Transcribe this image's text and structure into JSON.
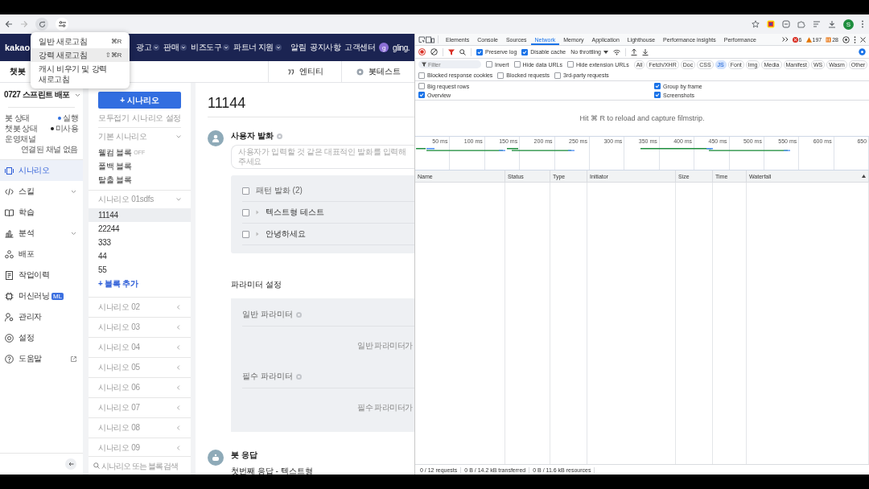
{
  "browser": {
    "avatar": "S"
  },
  "reload_menu": [
    {
      "label": "일반 새로고침",
      "shortcut": "⌘R",
      "highlighted": false
    },
    {
      "label": "강력 새로고침",
      "shortcut": "⇧⌘R",
      "highlighted": true
    },
    {
      "label": "캐시 비우기 및 강력 새로고침",
      "highlighted": false
    }
  ],
  "header": {
    "logo": "kakao",
    "menus": [
      "광고",
      "판매",
      "비즈도구",
      "파트너 지원"
    ],
    "links": [
      "알림",
      "공지사항",
      "고객센터"
    ],
    "user": {
      "initial": "g",
      "name": "gling."
    }
  },
  "subheader": {
    "title": "챗봇",
    "tabs": [
      "엔티티",
      "봇테스트"
    ]
  },
  "sidebar": {
    "bot_name": "0727 스프린트 배포",
    "status": [
      {
        "label": "봇 상태",
        "value": "실행",
        "color": "#2f6fdf"
      },
      {
        "label": "챗봇 상태",
        "value": "미사용",
        "color": "#222222"
      },
      {
        "label": "운영채널",
        "value": "연결된 채널 없음"
      }
    ],
    "nav": [
      {
        "label": "시나리오",
        "selected": true
      },
      {
        "label": "스킬",
        "selected": false,
        "expandable": true
      },
      {
        "label": "학습",
        "selected": false
      },
      {
        "label": "분석",
        "selected": false,
        "expandable": true
      },
      {
        "label": "배포",
        "selected": false
      },
      {
        "label": "작업이력",
        "selected": false
      },
      {
        "label": "머신러닝",
        "selected": false,
        "badge": "ML"
      },
      {
        "label": "관리자",
        "selected": false
      },
      {
        "label": "설정",
        "selected": false
      },
      {
        "label": "도움말",
        "selected": false,
        "external": true
      }
    ]
  },
  "scenarios": {
    "add_button": "+ 시나리오",
    "collapse_all": "모두접기",
    "settings": "시나리오 설정",
    "groups": [
      {
        "title": "기본 시나리오",
        "expanded": true,
        "blocks": [
          {
            "label": "웰컴 블록",
            "tag": "OFF",
            "selected": false
          },
          {
            "label": "폴백 블록",
            "selected": false
          },
          {
            "label": "탈출 블록",
            "selected": false
          }
        ]
      },
      {
        "title": "시나리오 01sdfs",
        "expanded": true,
        "blocks": [
          {
            "label": "11144",
            "selected": true
          },
          {
            "label": "22244",
            "selected": false
          },
          {
            "label": "333",
            "selected": false
          },
          {
            "label": "44",
            "selected": false
          },
          {
            "label": "55",
            "selected": false
          }
        ],
        "add_block": "+ 블록 추가"
      },
      {
        "title": "시나리오 02",
        "expanded": false
      },
      {
        "title": "시나리오 03",
        "expanded": false
      },
      {
        "title": "시나리오 04",
        "expanded": false
      },
      {
        "title": "시나리오 05",
        "expanded": false
      },
      {
        "title": "시나리오 06",
        "expanded": false
      },
      {
        "title": "시나리오 07",
        "expanded": false
      },
      {
        "title": "시나리오 08",
        "expanded": false
      },
      {
        "title": "시나리오 09",
        "expanded": false
      }
    ],
    "search": {
      "placeholder": "시나리오 또는 블록 검색"
    }
  },
  "main": {
    "title": "11144",
    "user_utterance": {
      "heading": "사용자 발화",
      "placeholder": "사용자가 입력할 것 같은 대표적인 발화를 입력해주세요",
      "items": [
        {
          "kind": "group",
          "label": "패턴 발화 (2)",
          "checked": false
        },
        {
          "kind": "utterance",
          "label": "텍스트형 테스트",
          "checked": false
        },
        {
          "kind": "utterance",
          "label": "안녕하세요",
          "checked": false
        }
      ]
    },
    "parameters": {
      "heading": "파라미터 설정",
      "sections": [
        {
          "title": "일반 파라미터",
          "empty_text": "일반 파라미터가"
        },
        {
          "title": "필수 파라미터",
          "empty_text": "필수 파라미터가"
        }
      ]
    },
    "bot_response": {
      "heading": "봇 응답",
      "subtitle": "첫번째 응답 - 텍스트형"
    }
  },
  "devtools": {
    "tabs": [
      {
        "label": "Elements",
        "selected": false
      },
      {
        "label": "Console",
        "selected": false
      },
      {
        "label": "Sources",
        "selected": false
      },
      {
        "label": "Network",
        "selected": true
      },
      {
        "label": "Memory",
        "selected": false
      },
      {
        "label": "Application",
        "selected": false
      },
      {
        "label": "Lighthouse",
        "selected": false
      },
      {
        "label": "Performance insights",
        "selected": false
      },
      {
        "label": "Performance",
        "selected": false
      }
    ],
    "issue_counts": [
      {
        "kind": "error",
        "count": "6"
      },
      {
        "kind": "warning",
        "count": "197"
      },
      {
        "kind": "issue",
        "count": "28"
      }
    ],
    "recording": true,
    "toolbar_checks": [
      {
        "label": "Preserve log",
        "checked": true
      },
      {
        "label": "Disable cache",
        "checked": true
      }
    ],
    "throttling": "No throttling",
    "filter": {
      "placeholder": "Filter"
    },
    "filter_checks": [
      {
        "label": "Invert",
        "checked": false
      },
      {
        "label": "Hide data URLs",
        "checked": false
      },
      {
        "label": "Hide extension URLs",
        "checked": false
      }
    ],
    "type_filters": [
      {
        "label": "All",
        "selected": false
      },
      {
        "label": "Fetch/XHR",
        "selected": false
      },
      {
        "label": "Doc",
        "selected": false
      },
      {
        "label": "CSS",
        "selected": false
      },
      {
        "label": "JS",
        "selected": true
      },
      {
        "label": "Font",
        "selected": false
      },
      {
        "label": "Img",
        "selected": false
      },
      {
        "label": "Media",
        "selected": false
      },
      {
        "label": "Manifest",
        "selected": false
      },
      {
        "label": "WS",
        "selected": false
      },
      {
        "label": "Wasm",
        "selected": false
      },
      {
        "label": "Other",
        "selected": false
      }
    ],
    "block_checks": [
      {
        "label": "Blocked response cookies",
        "checked": false
      },
      {
        "label": "Blocked requests",
        "checked": false
      },
      {
        "label": "3rd-party requests",
        "checked": false
      }
    ],
    "settings": [
      {
        "label": "Big request rows",
        "checked": false
      },
      {
        "label": "Group by frame",
        "checked": true
      },
      {
        "label": "Overview",
        "checked": true
      },
      {
        "label": "Screenshots",
        "checked": true
      }
    ],
    "filmstrip_hint": "Hit ⌘ R to reload and capture filmstrip.",
    "overview_ticks": [
      "50 ms",
      "100 ms",
      "150 ms",
      "200 ms",
      "250 ms",
      "300 ms",
      "350 ms",
      "400 ms",
      "450 ms",
      "500 ms",
      "550 ms",
      "600 ms",
      "650"
    ],
    "columns": [
      {
        "label": "Name",
        "sorted": false
      },
      {
        "label": "Status",
        "sorted": false
      },
      {
        "label": "Type",
        "sorted": false
      },
      {
        "label": "Initiator",
        "sorted": false
      },
      {
        "label": "Size",
        "sorted": false
      },
      {
        "label": "Time",
        "sorted": false
      },
      {
        "label": "Waterfall",
        "sorted": true
      }
    ],
    "status_bar": [
      "0 / 12 requests",
      "0 B / 14.2 kB transferred",
      "0 B / 11.6 kB resources"
    ]
  }
}
